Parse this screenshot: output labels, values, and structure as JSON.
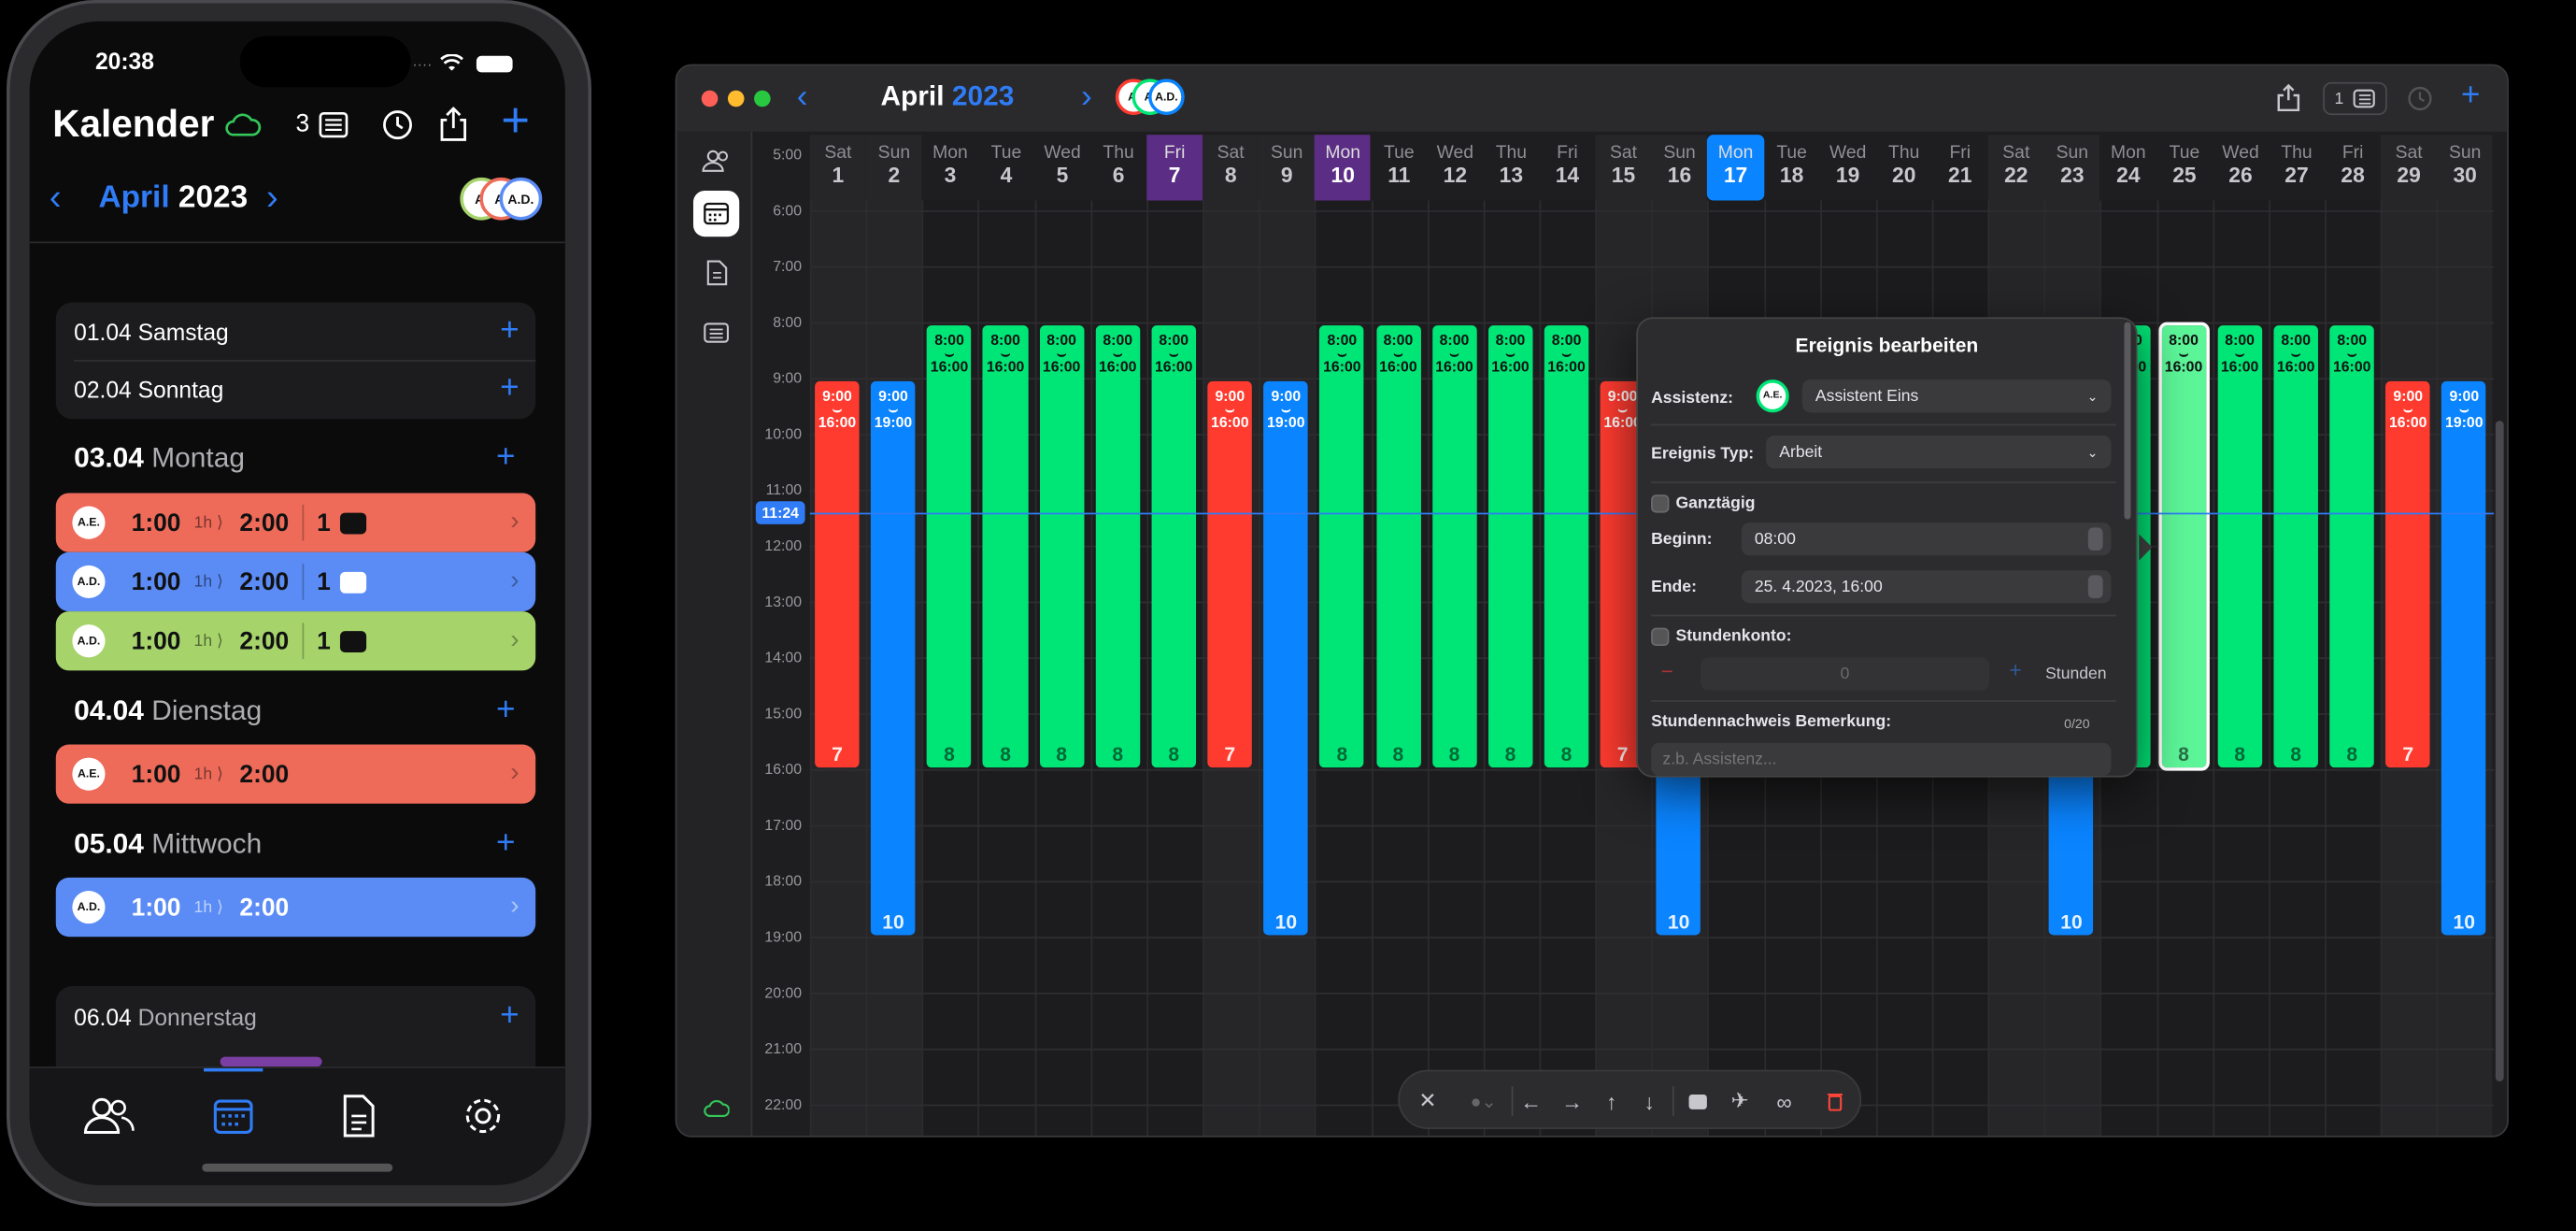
{
  "phone": {
    "status_time": "20:38",
    "title": "Kalender",
    "badge_count": "3",
    "month": "April",
    "year": "2023",
    "avatars": [
      "A.",
      "A.",
      "A.D."
    ],
    "days": [
      {
        "date": "01.04",
        "name": "Samstag"
      },
      {
        "date": "02.04",
        "name": "Sonntag"
      },
      {
        "date": "03.04",
        "name": "Montag"
      },
      {
        "date": "04.04",
        "name": "Dienstag"
      },
      {
        "date": "05.04",
        "name": "Mittwoch"
      },
      {
        "date": "06.04",
        "name": "Donnerstag"
      }
    ],
    "events": [
      {
        "avatar": "A.E.",
        "start": "1:00",
        "dur": "1h",
        "end": "2:00",
        "count": "1",
        "color": "#ee6b5a"
      },
      {
        "avatar": "A.D.",
        "start": "1:00",
        "dur": "1h",
        "end": "2:00",
        "count": "1",
        "color": "#5b8cf5"
      },
      {
        "avatar": "A.D.",
        "start": "1:00",
        "dur": "1h",
        "end": "2:00",
        "count": "1",
        "color": "#a6d46b"
      },
      {
        "avatar": "A.E.",
        "start": "1:00",
        "dur": "1h",
        "end": "2:00",
        "color": "#ee6b5a"
      },
      {
        "avatar": "A.D.",
        "start": "1:00",
        "dur": "1h",
        "end": "2:00",
        "color": "#5b8cf5"
      }
    ],
    "tabs": [
      "people-icon",
      "calendar-icon",
      "document-icon",
      "gear-icon"
    ]
  },
  "mac": {
    "month": "April",
    "year": "2023",
    "avatars": [
      "A.",
      "A.",
      "A.D."
    ],
    "badge_count": "1",
    "days": [
      {
        "wd": "Sat",
        "d": "1",
        "weekend": true
      },
      {
        "wd": "Sun",
        "d": "2",
        "weekend": true
      },
      {
        "wd": "Mon",
        "d": "3"
      },
      {
        "wd": "Tue",
        "d": "4"
      },
      {
        "wd": "Wed",
        "d": "5"
      },
      {
        "wd": "Thu",
        "d": "6"
      },
      {
        "wd": "Fri",
        "d": "7",
        "mark": "purple"
      },
      {
        "wd": "Sat",
        "d": "8",
        "weekend": true
      },
      {
        "wd": "Sun",
        "d": "9",
        "weekend": true
      },
      {
        "wd": "Mon",
        "d": "10",
        "mark": "purple"
      },
      {
        "wd": "Tue",
        "d": "11"
      },
      {
        "wd": "Wed",
        "d": "12"
      },
      {
        "wd": "Thu",
        "d": "13"
      },
      {
        "wd": "Fri",
        "d": "14"
      },
      {
        "wd": "Sat",
        "d": "15",
        "weekend": true
      },
      {
        "wd": "Sun",
        "d": "16",
        "weekend": true
      },
      {
        "wd": "Mon",
        "d": "17",
        "mark": "today"
      },
      {
        "wd": "Tue",
        "d": "18"
      },
      {
        "wd": "Wed",
        "d": "19"
      },
      {
        "wd": "Thu",
        "d": "20"
      },
      {
        "wd": "Fri",
        "d": "21"
      },
      {
        "wd": "Sat",
        "d": "22",
        "weekend": true
      },
      {
        "wd": "Sun",
        "d": "23",
        "weekend": true
      },
      {
        "wd": "Mon",
        "d": "24"
      },
      {
        "wd": "Tue",
        "d": "25"
      },
      {
        "wd": "Wed",
        "d": "26"
      },
      {
        "wd": "Thu",
        "d": "27"
      },
      {
        "wd": "Fri",
        "d": "28"
      },
      {
        "wd": "Sat",
        "d": "29",
        "weekend": true
      },
      {
        "wd": "Sun",
        "d": "30",
        "weekend": true
      }
    ],
    "times": [
      "5:00",
      "6:00",
      "7:00",
      "8:00",
      "9:00",
      "10:00",
      "11:00",
      "12:00",
      "13:00",
      "14:00",
      "15:00",
      "16:00",
      "17:00",
      "18:00",
      "19:00",
      "20:00",
      "21:00",
      "22:00"
    ],
    "now_label": "11:24",
    "now_hour": 11.4,
    "events": [
      {
        "day": 1,
        "start": "9:00",
        "end": "16:00",
        "s": 9,
        "e": 16,
        "hours": "7",
        "color": "red"
      },
      {
        "day": 2,
        "start": "9:00",
        "end": "19:00",
        "s": 9,
        "e": 19,
        "hours": "10",
        "color": "blue"
      },
      {
        "day": 3,
        "start": "8:00",
        "end": "16:00",
        "s": 8,
        "e": 16,
        "hours": "8",
        "color": "green"
      },
      {
        "day": 4,
        "start": "8:00",
        "end": "16:00",
        "s": 8,
        "e": 16,
        "hours": "8",
        "color": "green"
      },
      {
        "day": 5,
        "start": "8:00",
        "end": "16:00",
        "s": 8,
        "e": 16,
        "hours": "8",
        "color": "green"
      },
      {
        "day": 6,
        "start": "8:00",
        "end": "16:00",
        "s": 8,
        "e": 16,
        "hours": "8",
        "color": "green"
      },
      {
        "day": 7,
        "start": "8:00",
        "end": "16:00",
        "s": 8,
        "e": 16,
        "hours": "8",
        "color": "green"
      },
      {
        "day": 8,
        "start": "9:00",
        "end": "16:00",
        "s": 9,
        "e": 16,
        "hours": "7",
        "color": "red"
      },
      {
        "day": 9,
        "start": "9:00",
        "end": "19:00",
        "s": 9,
        "e": 19,
        "hours": "10",
        "color": "blue"
      },
      {
        "day": 10,
        "start": "8:00",
        "end": "16:00",
        "s": 8,
        "e": 16,
        "hours": "8",
        "color": "green"
      },
      {
        "day": 11,
        "start": "8:00",
        "end": "16:00",
        "s": 8,
        "e": 16,
        "hours": "8",
        "color": "green"
      },
      {
        "day": 12,
        "start": "8:00",
        "end": "16:00",
        "s": 8,
        "e": 16,
        "hours": "8",
        "color": "green"
      },
      {
        "day": 13,
        "start": "8:00",
        "end": "16:00",
        "s": 8,
        "e": 16,
        "hours": "8",
        "color": "green"
      },
      {
        "day": 14,
        "start": "8:00",
        "end": "16:00",
        "s": 8,
        "e": 16,
        "hours": "8",
        "color": "green"
      },
      {
        "day": 15,
        "start": "9:00",
        "end": "16:00",
        "s": 9,
        "e": 16,
        "hours": "7",
        "color": "red"
      },
      {
        "day": 16,
        "start": "9:00",
        "end": "19:00",
        "s": 9,
        "e": 19,
        "hours": "10",
        "color": "blue"
      },
      {
        "day": 23,
        "start": "9:00",
        "end": "19:00",
        "s": 9,
        "e": 19,
        "hours": "10",
        "color": "blue"
      },
      {
        "day": 24,
        "start": "8:00",
        "end": "16:00",
        "s": 8,
        "e": 16,
        "hours": "8",
        "color": "green"
      },
      {
        "day": 25,
        "start": "8:00",
        "end": "16:00",
        "s": 8,
        "e": 16,
        "hours": "8",
        "color": "green",
        "selected": true
      },
      {
        "day": 26,
        "start": "8:00",
        "end": "16:00",
        "s": 8,
        "e": 16,
        "hours": "8",
        "color": "green"
      },
      {
        "day": 27,
        "start": "8:00",
        "end": "16:00",
        "s": 8,
        "e": 16,
        "hours": "8",
        "color": "green"
      },
      {
        "day": 28,
        "start": "8:00",
        "end": "16:00",
        "s": 8,
        "e": 16,
        "hours": "8",
        "color": "green"
      },
      {
        "day": 29,
        "start": "9:00",
        "end": "16:00",
        "s": 9,
        "e": 16,
        "hours": "7",
        "color": "red"
      },
      {
        "day": 30,
        "start": "9:00",
        "end": "19:00",
        "s": 9,
        "e": 19,
        "hours": "10",
        "color": "blue"
      }
    ],
    "popup": {
      "title": "Ereignis bearbeiten",
      "assistant_label": "Assistenz:",
      "assistant_avatar": "A.E.",
      "assistant_value": "Assistent Eins",
      "type_label": "Ereignis Typ:",
      "type_value": "Arbeit",
      "allday_label": "Ganztägig",
      "begin_label": "Beginn:",
      "begin_value": "08:00",
      "end_label": "Ende:",
      "end_value": "25. 4.2023, 16:00",
      "hours_label": "Stundenkonto:",
      "hours_value": "0",
      "hours_unit": "Stunden",
      "remark_label": "Stundennachweis Bemerkung:",
      "remark_count": "0/20",
      "remark_placeholder": "z.b. Assistenz..."
    }
  }
}
